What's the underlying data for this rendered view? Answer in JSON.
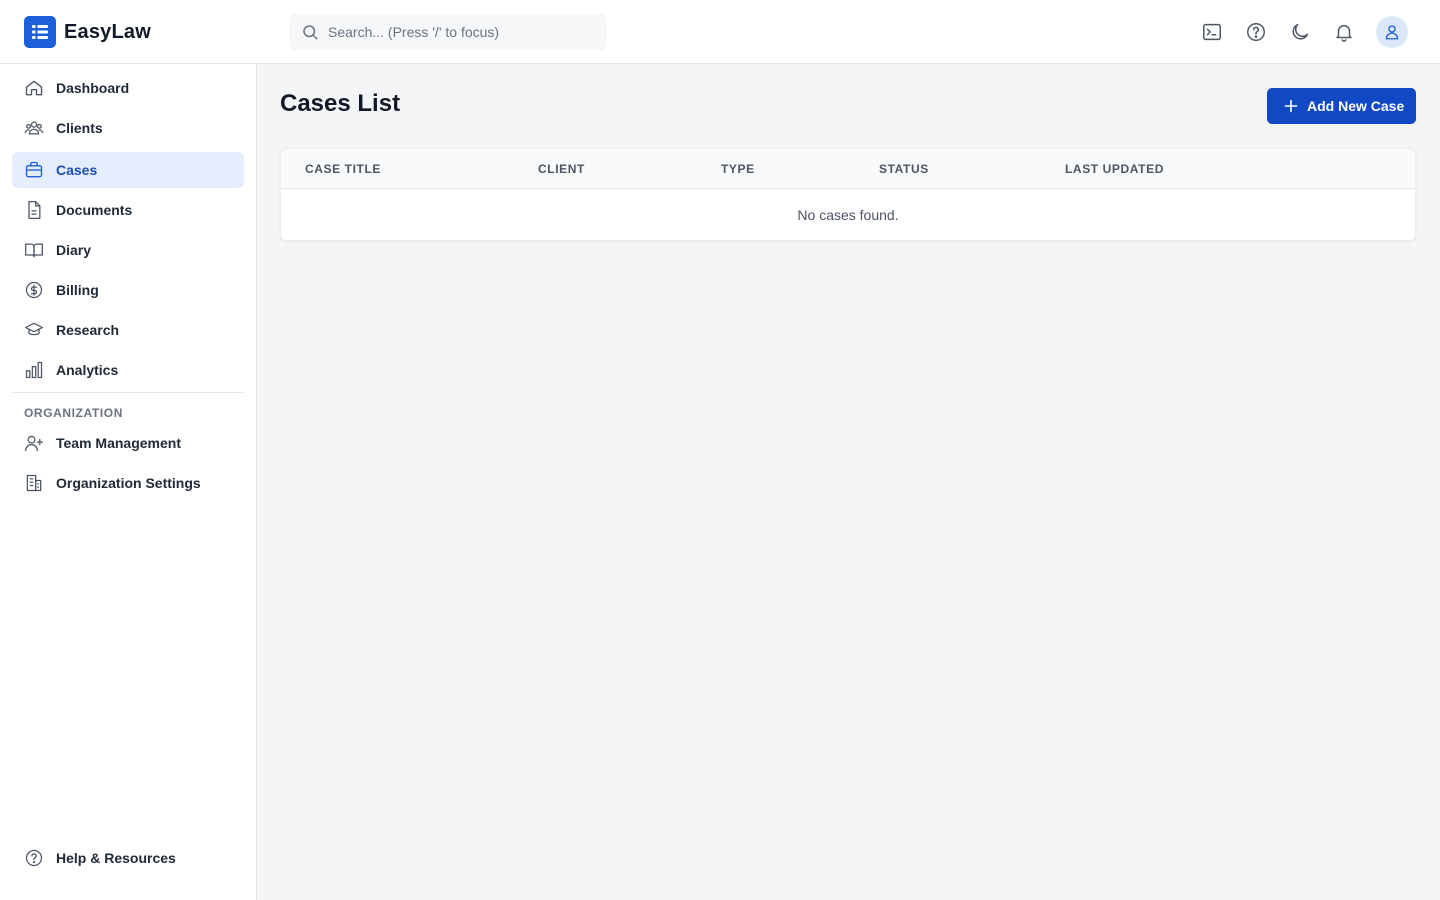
{
  "app": {
    "name": "EasyLaw",
    "logo_icon": "list-logo-icon",
    "accent_color": "#1148c4"
  },
  "search": {
    "placeholder": "Search... (Press '/' to focus)",
    "value": ""
  },
  "topbar": {
    "icons": [
      "terminal-icon",
      "help-circle-icon",
      "moon-icon",
      "bell-icon",
      "user-avatar-icon"
    ]
  },
  "sidebar": {
    "items": [
      {
        "label": "Dashboard",
        "icon": "home-icon"
      },
      {
        "label": "Clients",
        "icon": "users-icon"
      },
      {
        "label": "Cases",
        "icon": "briefcase-icon",
        "active": true
      },
      {
        "label": "Documents",
        "icon": "file-text-icon"
      },
      {
        "label": "Diary",
        "icon": "book-open-icon"
      },
      {
        "label": "Billing",
        "icon": "dollar-circle-icon"
      },
      {
        "label": "Research",
        "icon": "graduation-cap-icon"
      },
      {
        "label": "Analytics",
        "icon": "bar-chart-icon"
      }
    ],
    "section_label": "ORGANIZATION",
    "org_items": [
      {
        "label": "Team Management",
        "icon": "user-plus-icon"
      },
      {
        "label": "Organization Settings",
        "icon": "building-icon"
      }
    ],
    "footer_item": {
      "label": "Help & Resources",
      "icon": "help-circle-icon"
    }
  },
  "main": {
    "title": "Cases List",
    "add_button_label": "Add New Case",
    "table": {
      "columns": [
        "CASE TITLE",
        "CLIENT",
        "TYPE",
        "STATUS",
        "LAST UPDATED"
      ],
      "rows": [],
      "empty_message": "No cases found."
    }
  }
}
